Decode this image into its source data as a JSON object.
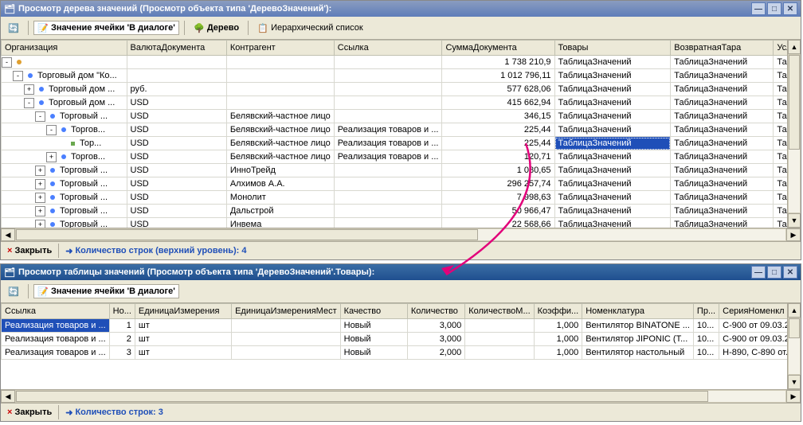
{
  "top": {
    "title": "Просмотр дерева значений (Просмотр объекта типа 'ДеревоЗначений'):",
    "toolbar": {
      "refresh_tip": "Обновить",
      "cell_value": "Значение ячейки 'В диалоге'",
      "tree": "Дерево",
      "h_list": "Иерархический список"
    },
    "columns": [
      {
        "label": "Организация",
        "w": 160
      },
      {
        "label": "ВалютаДокумента",
        "w": 130
      },
      {
        "label": "Контрагент",
        "w": 125
      },
      {
        "label": "Ссылка",
        "w": 130
      },
      {
        "label": "СуммаДокумента",
        "w": 150
      },
      {
        "label": "Товары",
        "w": 155
      },
      {
        "label": "ВозвратнаяТара",
        "w": 135
      },
      {
        "label": "Услу",
        "w": 33
      }
    ],
    "rows": [
      {
        "depth": 0,
        "toggle": "-",
        "kind": "root",
        "org": "",
        "val": "",
        "kontr": "",
        "link": "",
        "sum": "1 738 210,9",
        "tov": "ТаблицаЗначений",
        "voz": "ТаблицаЗначений",
        "usl": "Табл"
      },
      {
        "depth": 1,
        "toggle": "-",
        "kind": "node",
        "org": "Торговый дом \"Ко...",
        "val": "",
        "kontr": "",
        "link": "",
        "sum": "1 012 796,11",
        "tov": "ТаблицаЗначений",
        "voz": "ТаблицаЗначений",
        "usl": "Табл"
      },
      {
        "depth": 2,
        "toggle": "+",
        "kind": "node",
        "org": "Торговый дом ...",
        "val": "руб.",
        "kontr": "",
        "link": "",
        "sum": "577 628,06",
        "tov": "ТаблицаЗначений",
        "voz": "ТаблицаЗначений",
        "usl": "Табл"
      },
      {
        "depth": 2,
        "toggle": "-",
        "kind": "node",
        "org": "Торговый дом ...",
        "val": "USD",
        "kontr": "",
        "link": "",
        "sum": "415 662,94",
        "tov": "ТаблицаЗначений",
        "voz": "ТаблицаЗначений",
        "usl": "Табл"
      },
      {
        "depth": 3,
        "toggle": "-",
        "kind": "node",
        "org": "Торговый ...",
        "val": "USD",
        "kontr": "Белявский-частное лицо",
        "link": "",
        "sum": "346,15",
        "tov": "ТаблицаЗначений",
        "voz": "ТаблицаЗначений",
        "usl": "Табл"
      },
      {
        "depth": 4,
        "toggle": "-",
        "kind": "node",
        "org": "Торгов...",
        "val": "USD",
        "kontr": "Белявский-частное лицо",
        "link": "Реализация товаров и ...",
        "sum": "225,44",
        "tov": "ТаблицаЗначений",
        "voz": "ТаблицаЗначений",
        "usl": "Табл"
      },
      {
        "depth": 5,
        "toggle": "",
        "kind": "leaf",
        "org": "Тор...",
        "val": "USD",
        "kontr": "Белявский-частное лицо",
        "link": "Реализация товаров и ...",
        "sum": "225,44",
        "tov": "ТаблицаЗначений",
        "tov_sel": true,
        "voz": "ТаблицаЗначений",
        "usl": "Табл"
      },
      {
        "depth": 4,
        "toggle": "+",
        "kind": "node",
        "org": "Торгов...",
        "val": "USD",
        "kontr": "Белявский-частное лицо",
        "link": "Реализация товаров и ...",
        "sum": "120,71",
        "tov": "ТаблицаЗначений",
        "voz": "ТаблицаЗначений",
        "usl": "Табл"
      },
      {
        "depth": 3,
        "toggle": "+",
        "kind": "node",
        "org": "Торговый ...",
        "val": "USD",
        "kontr": "ИнноТрейд",
        "link": "",
        "sum": "1 080,65",
        "tov": "ТаблицаЗначений",
        "voz": "ТаблицаЗначений",
        "usl": "Табл"
      },
      {
        "depth": 3,
        "toggle": "+",
        "kind": "node",
        "org": "Торговый ...",
        "val": "USD",
        "kontr": "Алхимов А.А.",
        "link": "",
        "sum": "296 257,74",
        "tov": "ТаблицаЗначений",
        "voz": "ТаблицаЗначений",
        "usl": "Табл"
      },
      {
        "depth": 3,
        "toggle": "+",
        "kind": "node",
        "org": "Торговый ...",
        "val": "USD",
        "kontr": "Монолит",
        "link": "",
        "sum": "7 998,63",
        "tov": "ТаблицаЗначений",
        "voz": "ТаблицаЗначений",
        "usl": "Табл"
      },
      {
        "depth": 3,
        "toggle": "+",
        "kind": "node",
        "org": "Торговый ...",
        "val": "USD",
        "kontr": "Дальстрой",
        "link": "",
        "sum": "50 966,47",
        "tov": "ТаблицаЗначений",
        "voz": "ТаблицаЗначений",
        "usl": "Табл"
      },
      {
        "depth": 3,
        "toggle": "+",
        "kind": "node",
        "org": "Торговый ...",
        "val": "USD",
        "kontr": "Инвема",
        "link": "",
        "sum": "22 568,66",
        "tov": "ТаблицаЗначений",
        "voz": "ТаблицаЗначений",
        "usl": "Табл"
      }
    ],
    "status": {
      "close": "Закрыть",
      "rows": "Количество строк (верхний уровень): 4"
    }
  },
  "bottom": {
    "title": "Просмотр таблицы значений (Просмотр объекта типа 'ДеревоЗначений'.Товары):",
    "toolbar": {
      "cell_value": "Значение ячейки 'В диалоге'"
    },
    "columns": [
      {
        "label": "Ссылка",
        "w": 120
      },
      {
        "label": "Но...",
        "w": 30
      },
      {
        "label": "ЕдиницаИзмерения",
        "w": 140
      },
      {
        "label": "ЕдиницаИзмеренияМест",
        "w": 130
      },
      {
        "label": "Качество",
        "w": 135
      },
      {
        "label": "Количество",
        "w": 80
      },
      {
        "label": "КоличествоМ...",
        "w": 85
      },
      {
        "label": "Коэффи...",
        "w": 50
      },
      {
        "label": "Номенклатура",
        "w": 130
      },
      {
        "label": "Пр...",
        "w": 28
      },
      {
        "label": "СерияНоменкл",
        "w": 80
      }
    ],
    "rows": [
      {
        "sel": true,
        "link": "Реализация товаров и ...",
        "no": "1",
        "ed": "шт",
        "edm": "",
        "kach": "Новый",
        "kol": "3,000",
        "kolm": "",
        "koef": "1,000",
        "nom": "Вентилятор BINATONE ...",
        "pr": "10...",
        "ser": "С-900 от 09.03.2..."
      },
      {
        "link": "Реализация товаров и ...",
        "no": "2",
        "ed": "шт",
        "edm": "",
        "kach": "Новый",
        "kol": "3,000",
        "kolm": "",
        "koef": "1,000",
        "nom": "Вентилятор JIPONIC (Т...",
        "pr": "10...",
        "ser": "С-900 от 09.03.2..."
      },
      {
        "link": "Реализация товаров и ...",
        "no": "3",
        "ed": "шт",
        "edm": "",
        "kach": "Новый",
        "kol": "2,000",
        "kolm": "",
        "koef": "1,000",
        "nom": "Вентилятор настольный",
        "pr": "10...",
        "ser": "Н-890, С-890 от..."
      }
    ],
    "status": {
      "close": "Закрыть",
      "rows": "Количество строк: 3"
    }
  }
}
